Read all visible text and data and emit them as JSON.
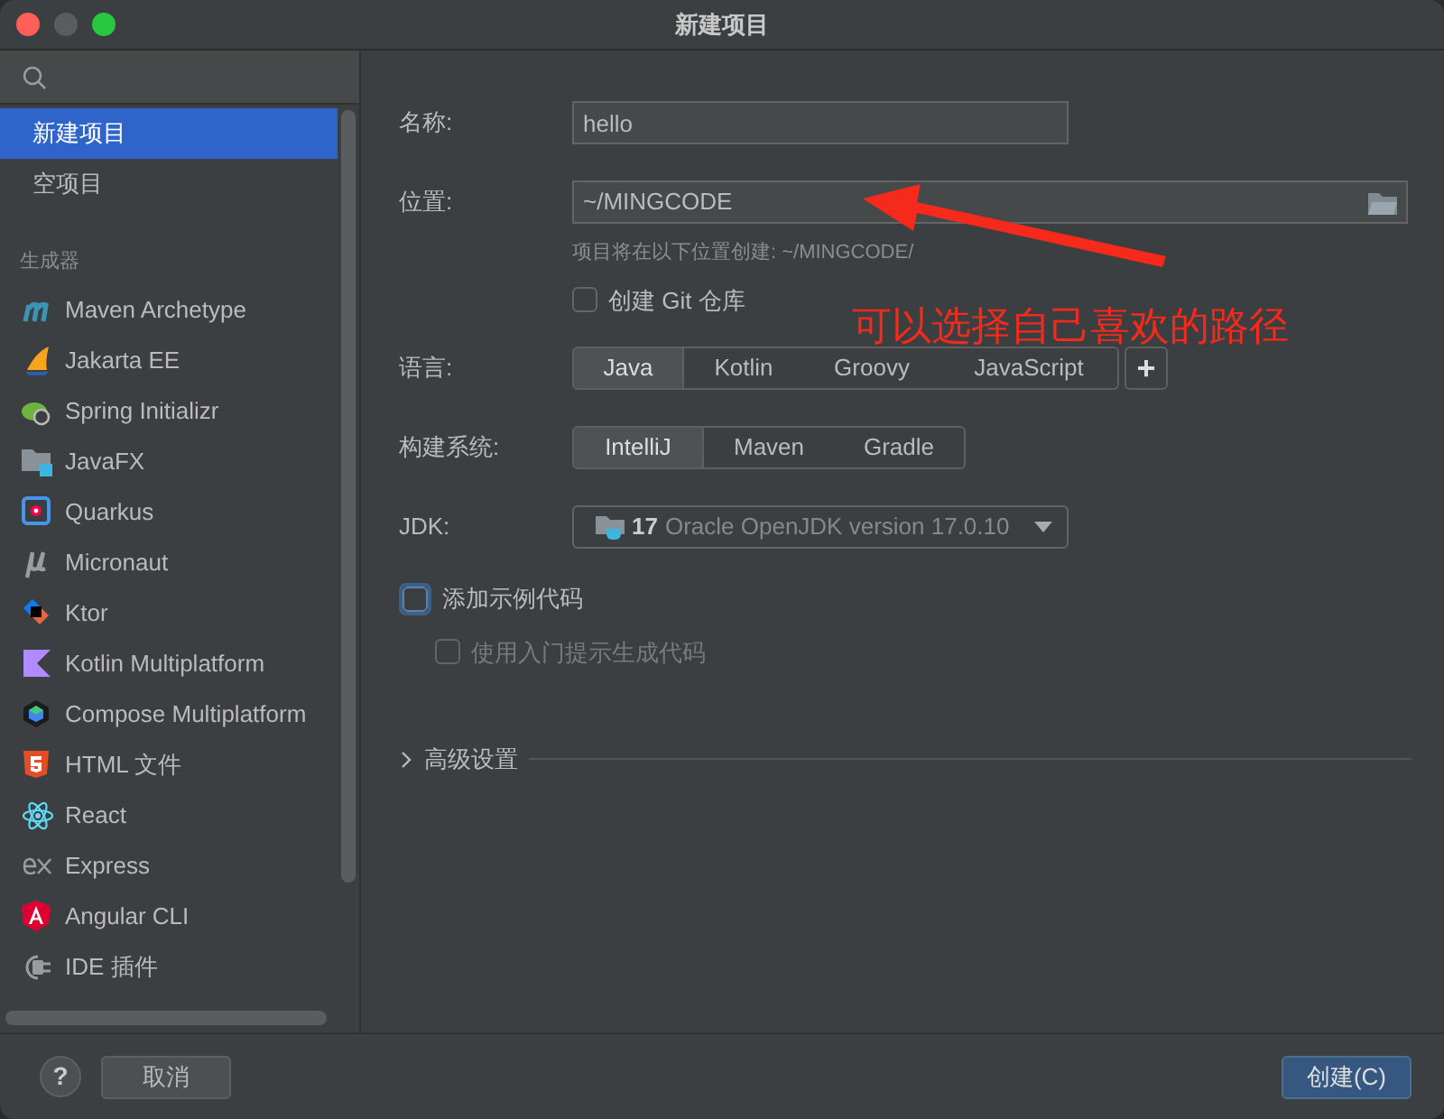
{
  "window": {
    "title": "新建项目"
  },
  "sidebar": {
    "items": [
      {
        "label": "新建项目",
        "selected": true
      },
      {
        "label": "空项目",
        "selected": false
      }
    ],
    "section": "生成器",
    "generators": [
      {
        "label": "Maven Archetype",
        "selected": false
      },
      {
        "label": "Jakarta EE",
        "selected": false
      },
      {
        "label": "Spring Initializr",
        "selected": false
      },
      {
        "label": "JavaFX",
        "selected": false
      },
      {
        "label": "Quarkus",
        "selected": false
      },
      {
        "label": "Micronaut",
        "selected": false
      },
      {
        "label": "Ktor",
        "selected": false
      },
      {
        "label": "Kotlin Multiplatform",
        "selected": false
      },
      {
        "label": "Compose Multiplatform",
        "selected": false
      },
      {
        "label": "HTML 文件",
        "selected": false
      },
      {
        "label": "React",
        "selected": false
      },
      {
        "label": "Express",
        "selected": false
      },
      {
        "label": "Angular CLI",
        "selected": false
      },
      {
        "label": "IDE 插件",
        "selected": false
      }
    ]
  },
  "form": {
    "name": {
      "label": "名称:",
      "value": "hello"
    },
    "location": {
      "label": "位置:",
      "value": "~/MINGCODE",
      "hint": "项目将在以下位置创建: ~/MINGCODE/"
    },
    "git": {
      "label": "创建 Git 仓库",
      "checked": false
    },
    "language": {
      "label": "语言:",
      "options": [
        {
          "label": "Java",
          "selected": true
        },
        {
          "label": "Kotlin",
          "selected": false
        },
        {
          "label": "Groovy",
          "selected": false
        },
        {
          "label": "JavaScript",
          "selected": false
        }
      ],
      "add": "+"
    },
    "build_system": {
      "label": "构建系统:",
      "options": [
        {
          "label": "IntelliJ",
          "selected": true
        },
        {
          "label": "Maven",
          "selected": false
        },
        {
          "label": "Gradle",
          "selected": false
        }
      ]
    },
    "jdk": {
      "label": "JDK:",
      "version": "17",
      "value": "Oracle OpenJDK version 17.0.10"
    },
    "sample_code": {
      "label": "添加示例代码",
      "checked": false,
      "focused": true
    },
    "onboarding_tips": {
      "label": "使用入门提示生成代码",
      "checked": false,
      "disabled": true
    },
    "advanced": {
      "label": "高级设置",
      "expanded": false
    }
  },
  "annotation": {
    "text": "可以选择自己喜欢的路径"
  },
  "footer": {
    "help": "?",
    "cancel": "取消",
    "create": "创建(C)"
  }
}
